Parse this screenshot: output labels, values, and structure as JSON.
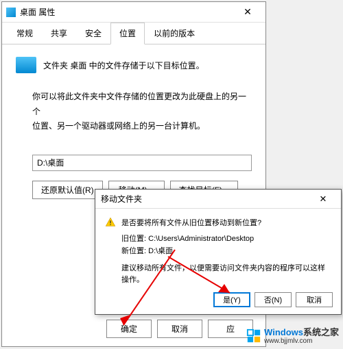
{
  "window": {
    "title": "桌面 属性",
    "close_glyph": "✕"
  },
  "tabs": {
    "general": "常规",
    "share": "共享",
    "security": "安全",
    "location": "位置",
    "previous": "以前的版本"
  },
  "content": {
    "folder_line": "文件夹 桌面 中的文件存储于以下目标位置。",
    "info1": "你可以将此文件夹中文件存储的位置更改为此硬盘上的另一个",
    "info2": "位置、另一个驱动器或网络上的另一台计算机。",
    "path_value": "D:\\桌面"
  },
  "buttons": {
    "restore": "还原默认值(R)",
    "move": "移动(M)...",
    "find": "查找目标(F)...",
    "ok": "确定",
    "cancel": "取消",
    "apply": "应"
  },
  "move_dialog": {
    "title": "移动文件夹",
    "close_glyph": "✕",
    "question": "是否要将所有文件从旧位置移动到新位置?",
    "old_label": "旧位置:",
    "old_path": "C:\\Users\\Administrator\\Desktop",
    "new_label": "新位置:",
    "new_path": "D:\\桌面",
    "advice": "建议移动所有文件，以便需要访问文件夹内容的程序可以这样操作。",
    "yes": "是(Y)",
    "no": "否(N)",
    "cancel": "取消"
  },
  "watermark": {
    "brand1": "Windows",
    "brand2": "系统之家",
    "url": "www.bjjmlv.com"
  }
}
